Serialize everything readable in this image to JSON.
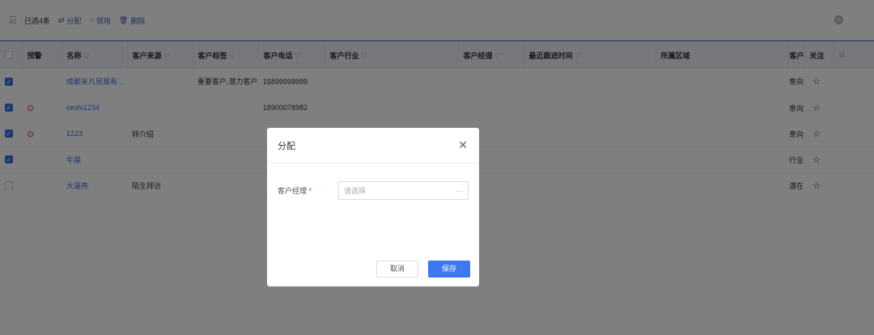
{
  "toolbar": {
    "selected": "已选4条",
    "assign": "分配",
    "claim": "领用",
    "delete": "删除"
  },
  "columns": [
    "预警",
    "名称",
    "客户来源",
    "客户标签",
    "客户电话",
    "客户行业",
    "客户经理",
    "最近跟进时间",
    "所属区域",
    "客户状态",
    "关注"
  ],
  "rows": [
    {
      "checked": true,
      "warning": false,
      "name": "成都米凡贸易有限...",
      "source": "",
      "tags": "重要客户,潜力客户",
      "phone": "15899999999",
      "status": "意向"
    },
    {
      "checked": true,
      "warning": true,
      "name": "ceshi1234",
      "source": "",
      "tags": "",
      "phone": "18900078982",
      "status": "意向"
    },
    {
      "checked": true,
      "warning": true,
      "name": "1223",
      "source": "转介绍",
      "tags": "",
      "phone": "",
      "status": "意向"
    },
    {
      "checked": true,
      "warning": false,
      "name": "牛屎",
      "source": "",
      "tags": "",
      "phone": "",
      "status": "行业"
    },
    {
      "checked": false,
      "warning": false,
      "name": "大逼壳",
      "source": "陌生拜访",
      "tags": "",
      "phone": "",
      "status": "潜在"
    }
  ],
  "modal": {
    "title": "分配",
    "field_label": "客户经理",
    "required_mark": "*",
    "placeholder": "请选择",
    "more": "···",
    "cancel": "取消",
    "save": "保存"
  },
  "colors": {
    "accent": "#3e78f0",
    "warning": "#d9252c"
  }
}
